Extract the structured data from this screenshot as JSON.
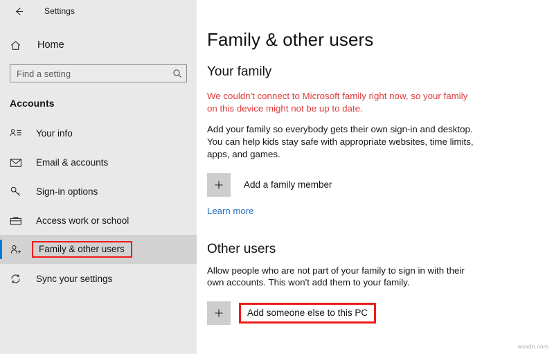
{
  "window": {
    "app_title": "Settings",
    "back_icon": "back-arrow-icon"
  },
  "sidebar": {
    "home": {
      "label": "Home",
      "icon": "home-icon"
    },
    "search": {
      "placeholder": "Find a setting",
      "value": "",
      "icon": "search-icon"
    },
    "group_title": "Accounts",
    "items": [
      {
        "label": "Your info",
        "icon": "contact-card-icon",
        "selected": false,
        "highlighted": false
      },
      {
        "label": "Email & accounts",
        "icon": "envelope-icon",
        "selected": false,
        "highlighted": false
      },
      {
        "label": "Sign-in options",
        "icon": "key-icon",
        "selected": false,
        "highlighted": false
      },
      {
        "label": "Access work or school",
        "icon": "briefcase-icon",
        "selected": false,
        "highlighted": false
      },
      {
        "label": "Family & other users",
        "icon": "person-plus-icon",
        "selected": true,
        "highlighted": true
      },
      {
        "label": "Sync your settings",
        "icon": "sync-icon",
        "selected": false,
        "highlighted": false
      }
    ]
  },
  "main": {
    "page_title": "Family & other users",
    "family": {
      "heading": "Your family",
      "error": "We couldn't connect to Microsoft family right now, so your family on this device might not be up to date.",
      "description": "Add your family so everybody gets their own sign-in and desktop. You can help kids stay safe with appropriate websites, time limits, apps, and games.",
      "add_button": {
        "label": "Add a family member",
        "icon": "plus-icon"
      },
      "learn_more": "Learn more"
    },
    "other_users": {
      "heading": "Other users",
      "description": "Allow people who are not part of your family to sign in with their own accounts. This won't add them to your family.",
      "add_button": {
        "label": "Add someone else to this PC",
        "icon": "plus-icon",
        "highlighted": true
      }
    }
  },
  "watermark": "wsxdn.com",
  "colors": {
    "accent": "#0078d7",
    "highlight_box": "#ee1b1b",
    "error_text": "#e03b3b",
    "link": "#1f6fc4",
    "sidebar_bg": "#e9e9e9",
    "selected_row": "#d2d2d2"
  }
}
